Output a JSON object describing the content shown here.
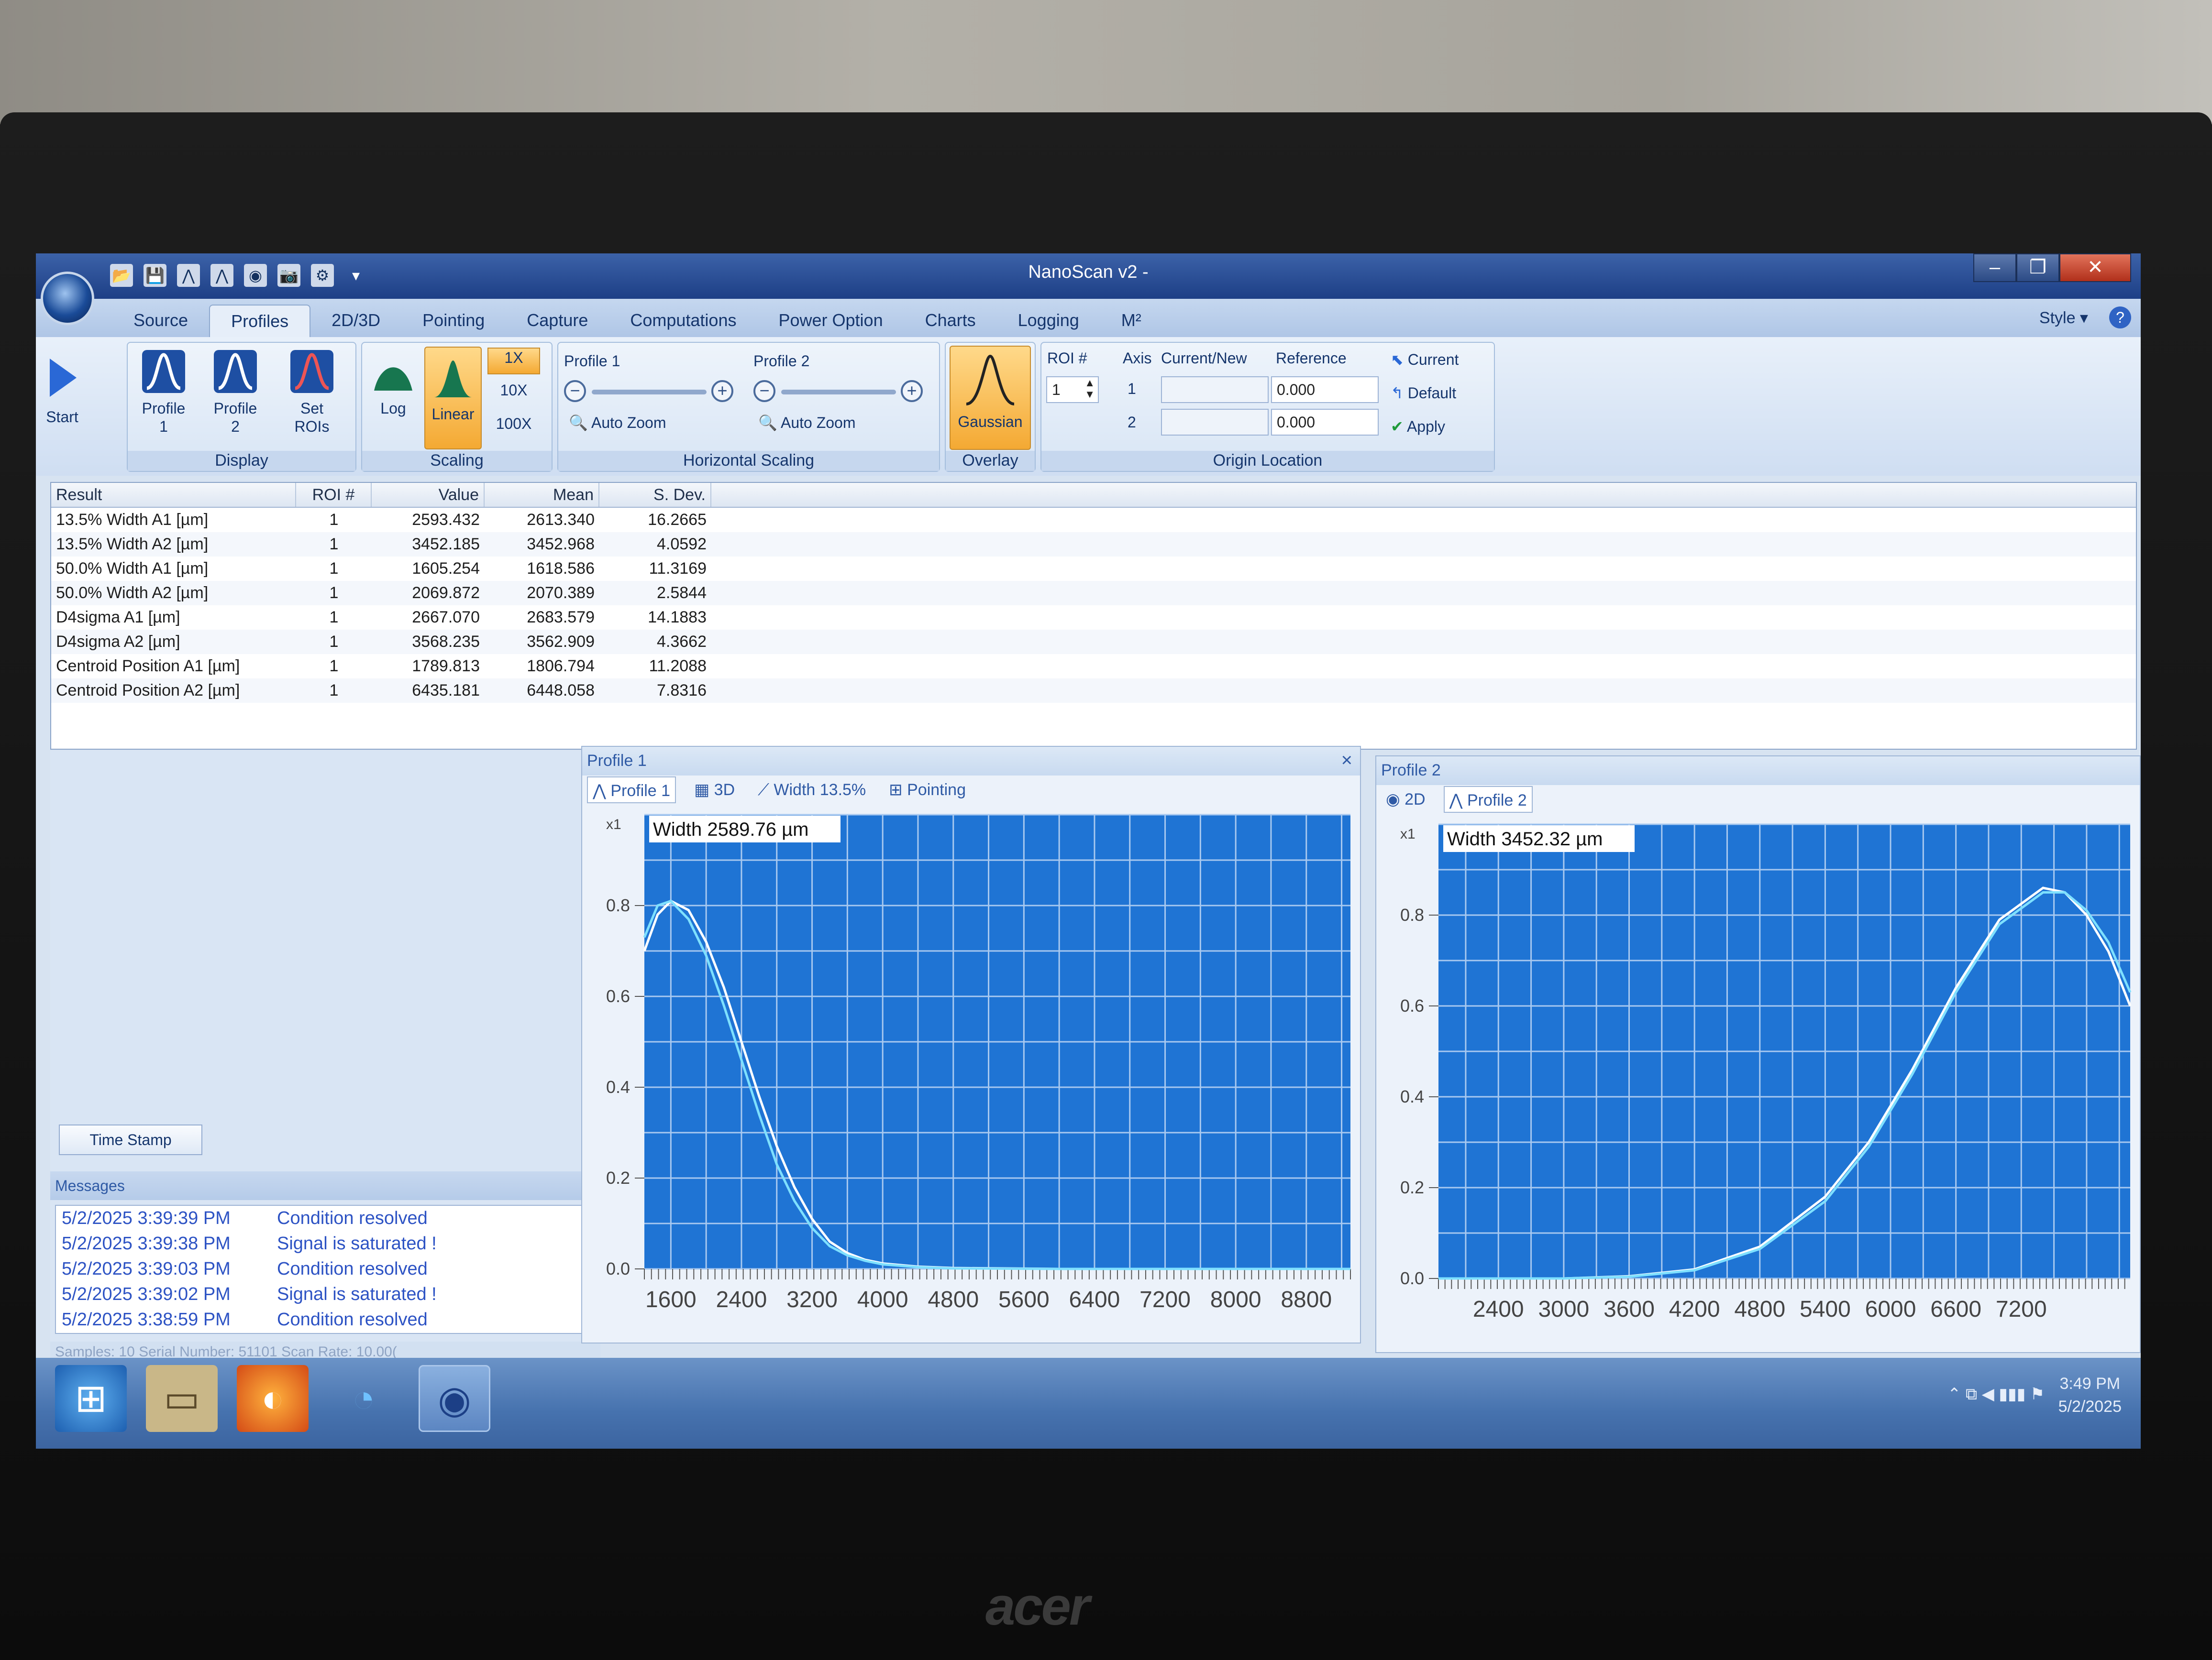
{
  "window": {
    "title": "NanoScan v2 -",
    "style_label": "Style",
    "help_label": "?"
  },
  "quick_access": [
    "📂",
    "💾",
    "⋀",
    "⋀",
    "◉",
    "📷",
    "⚙",
    "▾"
  ],
  "tabs": [
    "Source",
    "Profiles",
    "2D/3D",
    "Pointing",
    "Capture",
    "Computations",
    "Power Option",
    "Charts",
    "Logging",
    "M²"
  ],
  "ribbon": {
    "start": "Start",
    "display": {
      "label": "Display",
      "profile1": "Profile\n1",
      "profile2": "Profile\n2",
      "set_rois": "Set\nROIs"
    },
    "scaling": {
      "label": "Scaling",
      "log": "Log",
      "linear": "Linear",
      "x1": "1X",
      "x10": "10X",
      "x100": "100X"
    },
    "horizontal": {
      "label": "Horizontal Scaling",
      "p1": "Profile 1",
      "p2": "Profile 2",
      "auto_zoom": "Auto Zoom"
    },
    "overlay": {
      "label": "Overlay",
      "gaussian": "Gaussian"
    },
    "origin": {
      "label": "Origin Location",
      "roi_label": "ROI #",
      "roi_value": "1",
      "axis_header": "Axis",
      "cn_header": "Current/New",
      "ref_header": "Reference",
      "axis1": "1",
      "axis2": "2",
      "ref1": "0.000",
      "ref2": "0.000",
      "current": "Current",
      "default": "Default",
      "apply": "Apply"
    }
  },
  "results": {
    "headers": [
      "Result",
      "ROI #",
      "Value",
      "Mean",
      "S. Dev."
    ],
    "rows": [
      [
        "13.5% Width A1 [µm]",
        "1",
        "2593.432",
        "2613.340",
        "16.2665"
      ],
      [
        "13.5% Width A2 [µm]",
        "1",
        "3452.185",
        "3452.968",
        "4.0592"
      ],
      [
        "50.0% Width A1 [µm]",
        "1",
        "1605.254",
        "1618.586",
        "11.3169"
      ],
      [
        "50.0% Width A2 [µm]",
        "1",
        "2069.872",
        "2070.389",
        "2.5844"
      ],
      [
        "D4sigma A1 [µm]",
        "1",
        "2667.070",
        "2683.579",
        "14.1883"
      ],
      [
        "D4sigma A2 [µm]",
        "1",
        "3568.235",
        "3562.909",
        "4.3662"
      ],
      [
        "Centroid Position A1 [µm]",
        "1",
        "1789.813",
        "1806.794",
        "11.2088"
      ],
      [
        "Centroid Position A2 [µm]",
        "1",
        "6435.181",
        "6448.058",
        "7.8316"
      ]
    ]
  },
  "leftpane": {
    "timestamp_button": "Time Stamp",
    "messages_title": "Messages",
    "messages": [
      {
        "time": "5/2/2025 3:39:39 PM",
        "text": "Condition resolved"
      },
      {
        "time": "5/2/2025 3:39:38 PM",
        "text": "Signal is saturated !"
      },
      {
        "time": "5/2/2025 3:39:03 PM",
        "text": "Condition resolved"
      },
      {
        "time": "5/2/2025 3:39:02 PM",
        "text": "Signal is saturated !"
      },
      {
        "time": "5/2/2025 3:38:59 PM",
        "text": "Condition resolved"
      }
    ],
    "status": "Samples: 10        Serial Number: 51101        Scan Rate: 10.00("
  },
  "profile1": {
    "title": "Profile 1",
    "close": "×",
    "tabs": [
      "Profile 1",
      "3D",
      "Width 13.5%",
      "Pointing"
    ]
  },
  "profile2": {
    "title": "Profile 2",
    "tabs": [
      "2D",
      "Profile 2"
    ]
  },
  "chart_data": [
    {
      "type": "line",
      "title": "Profile 1",
      "annotation": "Width 2589.76 µm",
      "scale_label": "x1",
      "xlim": [
        1300,
        9300
      ],
      "ylim": [
        0,
        1.0
      ],
      "x_ticks": [
        1600,
        2400,
        3200,
        4000,
        4800,
        5600,
        6400,
        7200,
        8000,
        8800
      ],
      "y_ticks": [
        0.0,
        0.2,
        0.4,
        0.6,
        0.8
      ],
      "grid": true,
      "series": [
        {
          "values": [
            [
              1300,
              0.7
            ],
            [
              1450,
              0.78
            ],
            [
              1600,
              0.81
            ],
            [
              1800,
              0.79
            ],
            [
              2000,
              0.72
            ],
            [
              2200,
              0.62
            ],
            [
              2400,
              0.5
            ],
            [
              2600,
              0.38
            ],
            [
              2800,
              0.27
            ],
            [
              3000,
              0.18
            ],
            [
              3200,
              0.11
            ],
            [
              3400,
              0.06
            ],
            [
              3600,
              0.035
            ],
            [
              3800,
              0.02
            ],
            [
              4000,
              0.012
            ],
            [
              4400,
              0.005
            ],
            [
              4800,
              0.002
            ],
            [
              6000,
              0.0
            ],
            [
              9300,
              0.0
            ]
          ]
        },
        {
          "values": [
            [
              1300,
              0.73
            ],
            [
              1450,
              0.8
            ],
            [
              1600,
              0.81
            ],
            [
              1800,
              0.77
            ],
            [
              2000,
              0.69
            ],
            [
              2200,
              0.58
            ],
            [
              2400,
              0.46
            ],
            [
              2600,
              0.34
            ],
            [
              2800,
              0.23
            ],
            [
              3000,
              0.15
            ],
            [
              3200,
              0.09
            ],
            [
              3400,
              0.05
            ],
            [
              3600,
              0.03
            ],
            [
              3800,
              0.018
            ],
            [
              4000,
              0.01
            ],
            [
              4400,
              0.004
            ],
            [
              4800,
              0.001
            ],
            [
              6000,
              0.0
            ],
            [
              9300,
              0.0
            ]
          ]
        }
      ]
    },
    {
      "type": "line",
      "title": "Profile 2",
      "annotation": "Width 3452.32 µm",
      "scale_label": "x1",
      "xlim": [
        1850,
        8200
      ],
      "ylim": [
        0,
        1.0
      ],
      "x_ticks": [
        2400,
        3000,
        3600,
        4200,
        4800,
        5400,
        6000,
        6600,
        7200
      ],
      "y_ticks": [
        0.0,
        0.2,
        0.4,
        0.6,
        0.8
      ],
      "grid": true,
      "series": [
        {
          "values": [
            [
              1850,
              0.0
            ],
            [
              3000,
              0.0
            ],
            [
              3600,
              0.005
            ],
            [
              4200,
              0.02
            ],
            [
              4800,
              0.07
            ],
            [
              5400,
              0.18
            ],
            [
              5800,
              0.3
            ],
            [
              6200,
              0.46
            ],
            [
              6600,
              0.64
            ],
            [
              7000,
              0.79
            ],
            [
              7400,
              0.86
            ],
            [
              7600,
              0.85
            ],
            [
              7800,
              0.8
            ],
            [
              8000,
              0.72
            ],
            [
              8200,
              0.6
            ]
          ]
        },
        {
          "values": [
            [
              1850,
              0.0
            ],
            [
              3000,
              0.0
            ],
            [
              3600,
              0.004
            ],
            [
              4200,
              0.018
            ],
            [
              4800,
              0.065
            ],
            [
              5400,
              0.17
            ],
            [
              5800,
              0.29
            ],
            [
              6200,
              0.45
            ],
            [
              6600,
              0.63
            ],
            [
              7000,
              0.78
            ],
            [
              7400,
              0.85
            ],
            [
              7600,
              0.85
            ],
            [
              7800,
              0.81
            ],
            [
              8000,
              0.74
            ],
            [
              8200,
              0.63
            ]
          ]
        }
      ]
    }
  ],
  "taskbar": {
    "time": "3:49 PM",
    "date": "5/2/2025",
    "tray_icons": "⌃  ⧉  ◀  ▮▮▮  ⚑"
  },
  "laptop_brand": "acer"
}
